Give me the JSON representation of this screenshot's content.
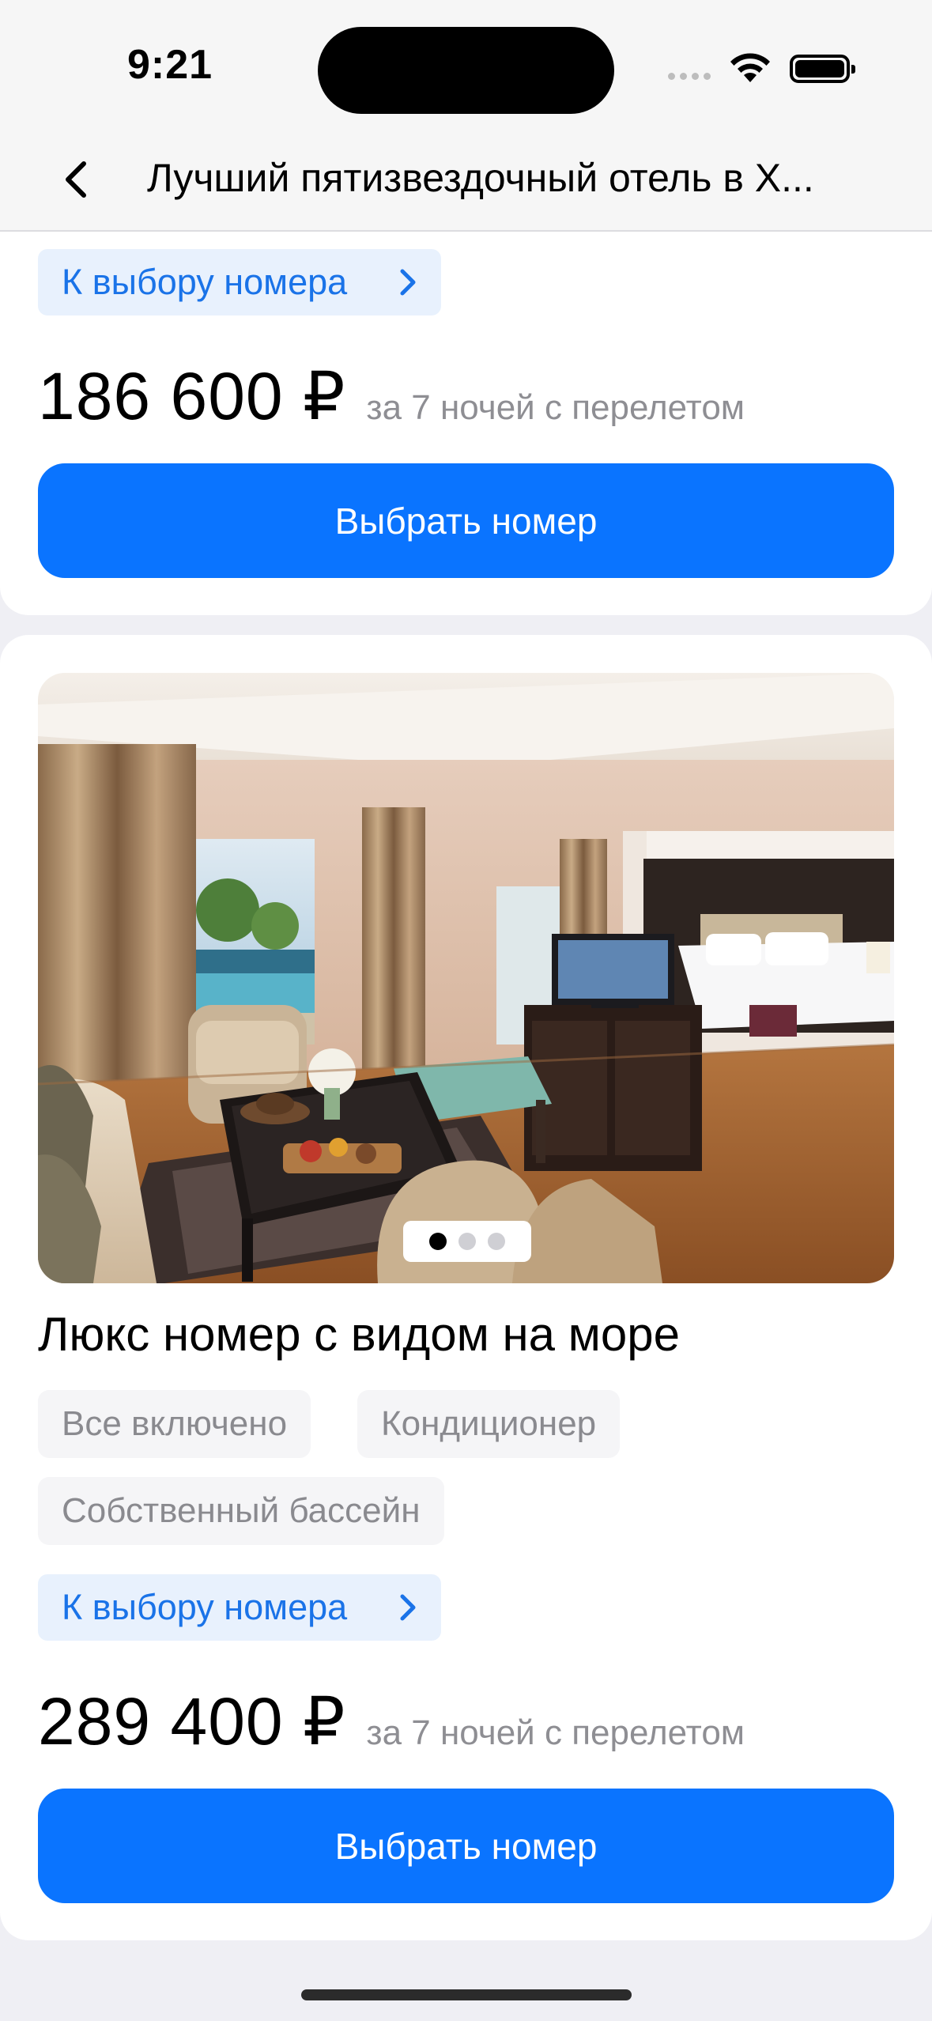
{
  "status_bar": {
    "time": "9:21"
  },
  "nav": {
    "title": "Лучший пятизвездочный отель в Х..."
  },
  "colors": {
    "accent": "#0a74ff",
    "link": "#1a73e8",
    "link_bg": "#e8f1fd",
    "muted": "#8e8e93",
    "page_bg": "#efeff4"
  },
  "icons": {
    "back": "chevron-left-icon",
    "link_chevron": "chevron-right-icon",
    "wifi": "wifi-icon",
    "battery": "battery-icon"
  },
  "prev_offer": {
    "link_label": "К выбору номера",
    "price": "186 600 ₽",
    "price_note": "за 7 ночей с перелетом",
    "button_label": "Выбрать номер"
  },
  "room": {
    "photo_count": 3,
    "photo_active_index": 0,
    "title": "Люкс номер с видом на море",
    "tags": [
      "Все включено",
      "Кондиционер",
      "Собственный бассейн"
    ],
    "link_label": "К выбору номера",
    "price": "289 400 ₽",
    "price_note": "за 7 ночей с перелетом",
    "button_label": "Выбрать номер"
  }
}
